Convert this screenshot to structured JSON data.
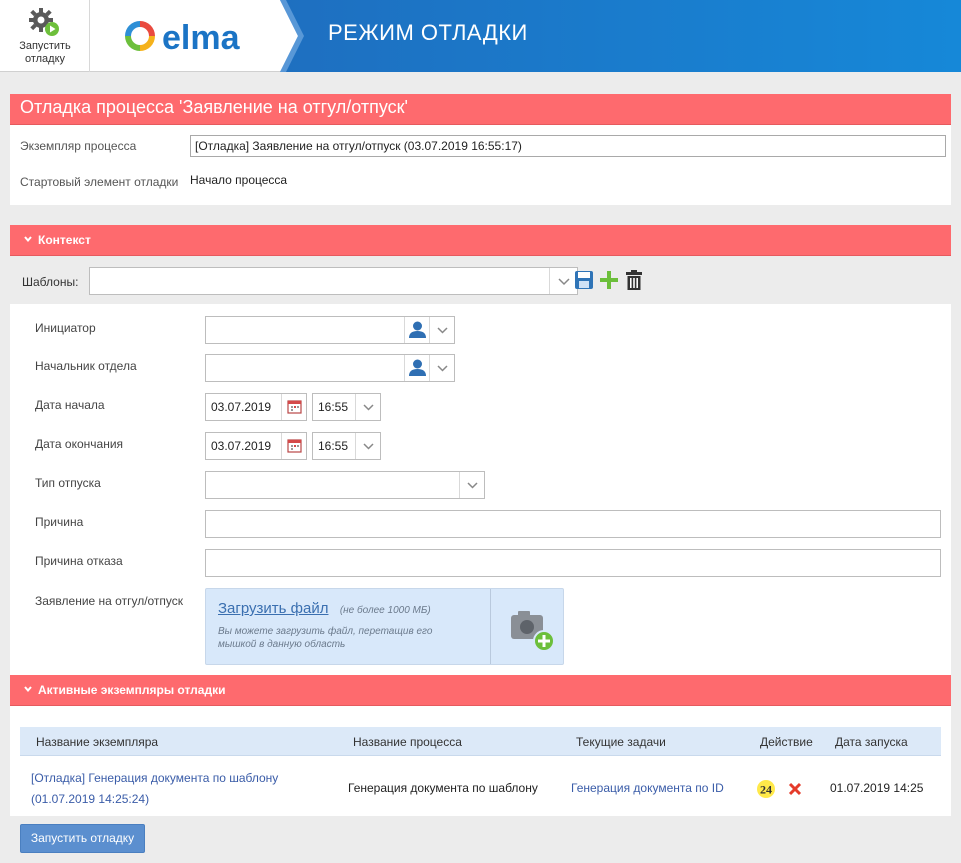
{
  "header": {
    "run_label_line1": "Запустить",
    "run_label_line2": "отладку",
    "logo_text": "elma",
    "title": "РЕЖИМ ОТЛАДКИ",
    "banner_color": "#1a72c6"
  },
  "process": {
    "title": "Отладка процесса 'Заявление на отгул/отпуск'",
    "instance_label": "Экземпляр процесса",
    "instance_value": "[Отладка] Заявление на отгул/отпуск (03.07.2019 16:55:17)",
    "start_element_label": "Стартовый элемент отладки",
    "start_element_value": "Начало процесса"
  },
  "context": {
    "section_title": "Контекст",
    "templates_label": "Шаблоны:",
    "templates_value": "",
    "fields": {
      "initiator_label": "Инициатор",
      "dept_head_label": "Начальник отдела",
      "start_date_label": "Дата начала",
      "start_date_value": "03.07.2019",
      "start_time_value": "16:55",
      "end_date_label": "Дата окончания",
      "end_date_value": "03.07.2019",
      "end_time_value": "16:55",
      "leave_type_label": "Тип отпуска",
      "reason_label": "Причина",
      "reject_reason_label": "Причина отказа",
      "application_label": "Заявление на отгул/отпуск"
    },
    "upload": {
      "link": "Загрузить файл",
      "limit": "(не более 1000 МБ)",
      "hint_line1": "Вы можете загрузить файл, перетащив его",
      "hint_line2": "мышкой в данную область"
    }
  },
  "instances": {
    "section_title": "Активные экземпляры отладки",
    "columns": [
      "Название экземпляра",
      "Название процесса",
      "Текущие задачи",
      "Действие",
      "Дата запуска"
    ],
    "rows": [
      {
        "name_line1": "[Отладка] Генерация документа по шаблону",
        "name_line2": "(01.07.2019 14:25:24)",
        "process": "Генерация документа по шаблону",
        "task": "Генерация документа по ID",
        "started": "01.07.2019 14:25"
      }
    ]
  },
  "footer": {
    "start_button": "Запустить отладку"
  },
  "colors": {
    "section_red": "#fe6a6e",
    "link_blue": "#3a5ca8",
    "table_head": "#dce9f8",
    "button_blue": "#5b8fcf"
  }
}
